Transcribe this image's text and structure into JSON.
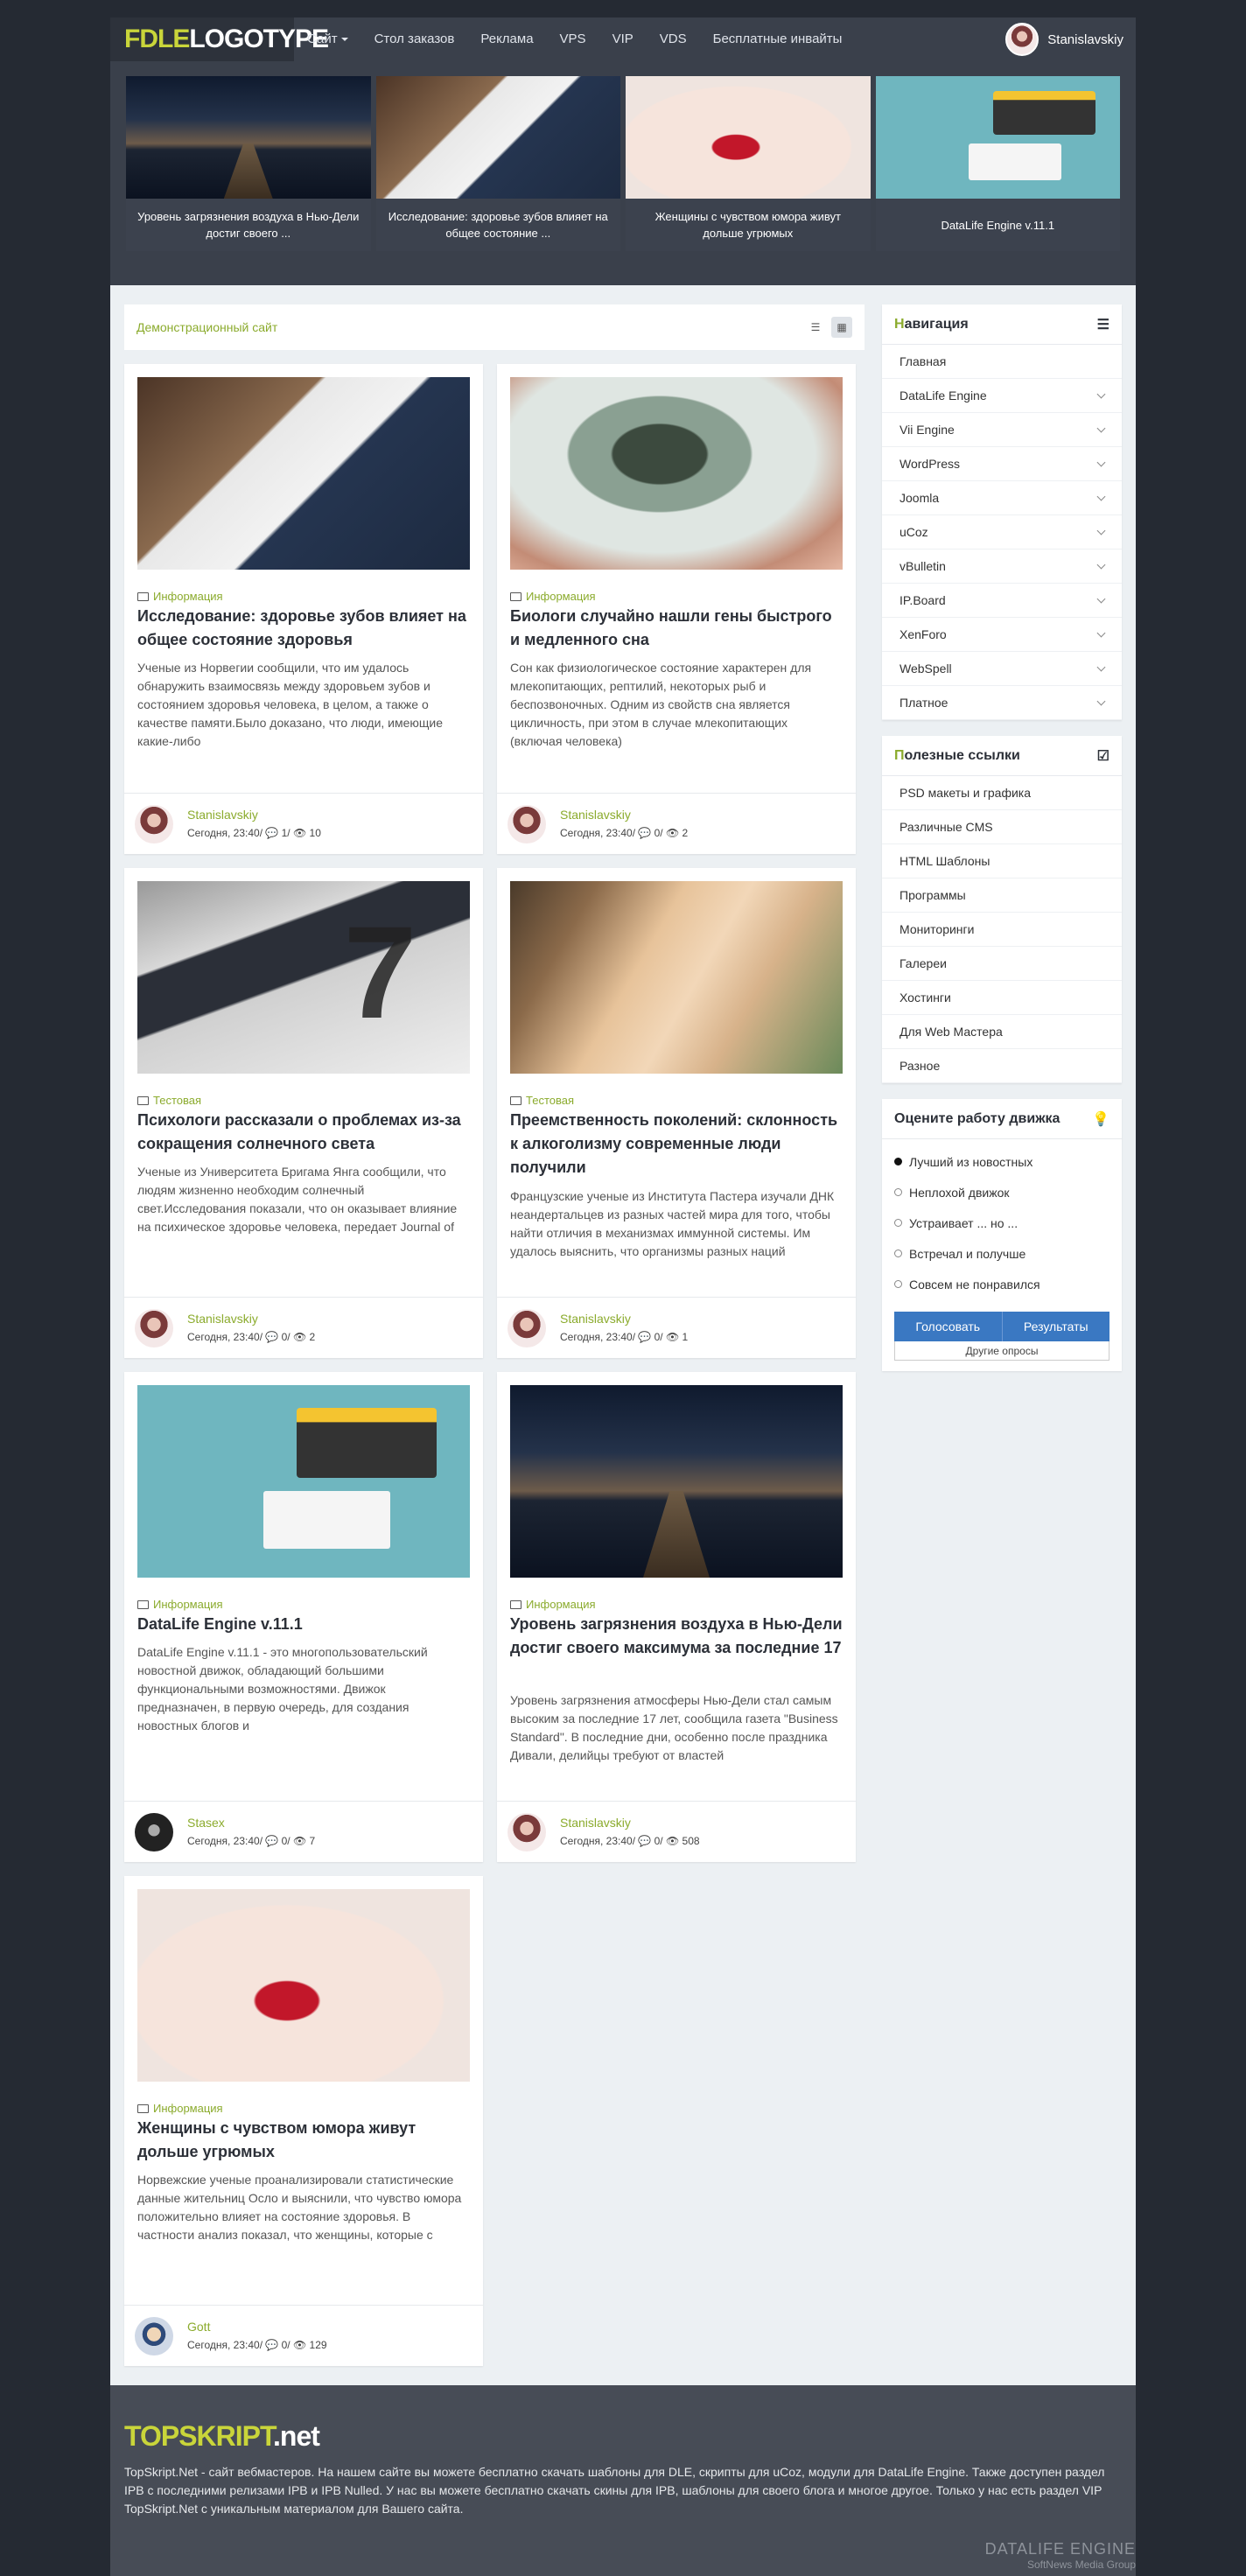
{
  "header": {
    "logo_a": "FDLE",
    "logo_b": "LOGOTYPE",
    "menu": [
      "Сайт",
      "Стол заказов",
      "Реклама",
      "VPS",
      "VIP",
      "VDS",
      "Бесплатные инвайты"
    ],
    "user_name": "Stanislavskiy"
  },
  "slider": [
    {
      "caption": "Уровень загрязнения воздуха в Нью-Дели достиг своего ..."
    },
    {
      "caption": "Исследование: здоровье зубов влияет на общее состояние ..."
    },
    {
      "caption": "Женщины с чувством юмора живут дольше угрюмых"
    },
    {
      "caption": "DataLife Engine v.11.1"
    }
  ],
  "breadcrumb": "Демонстрационный сайт",
  "icons": {
    "list_view": "list-icon",
    "grid_view": "grid-icon",
    "folder": "folder-icon",
    "comment": "comment-icon",
    "eye": "eye-icon",
    "menu": "hamburger-icon",
    "check": "checkbox-icon",
    "bulb": "lightbulb-icon"
  },
  "articles": [
    {
      "category": "Информация",
      "title": "Исследование: здоровье зубов влияет на общее состояние здоровья",
      "text": "Ученые из Норвегии сообщили, что им удалось обнаружить взаимосвязь между здоровьем зубов и состоянием здоровья человека, в целом, а также о качестве памяти.Было доказано, что люди, имеющие какие-либо",
      "author": "Stanislavskiy",
      "meta": "Сегодня, 23:40/ 💬 1/ 👁 10"
    },
    {
      "category": "Информация",
      "title": "Биологи случайно нашли гены быстрого и медленного сна",
      "text": "Сон как физиологическое состояние характерен для млекопитающих, рептилий, некоторых рыб и беспозвоночных. Одним из свойств сна является цикличность, при этом в случае млекопитающих (включая человека)",
      "author": "Stanislavskiy",
      "meta": "Сегодня, 23:40/ 💬 0/ 👁 2"
    },
    {
      "category": "Тестовая",
      "title": "Психологи рассказали о проблемах из-за сокращения солнечного света",
      "text": "Ученые из Университета Бригама Янга сообщили, что людям жизненно необходим солнечный свет.Исследования показали, что он оказывает влияние на психическое здоровье человека, передает Journal of",
      "author": "Stanislavskiy",
      "meta": "Сегодня, 23:40/ 💬 0/ 👁 2"
    },
    {
      "category": "Тестовая",
      "title": "Преемственность поколений: склонность к алкоголизму современные люди получили",
      "text": "Французские ученые из Института Пастера изучали ДНК неандертальцев из разных частей мира для того, чтобы найти отличия в механизмах иммунной системы. Им удалось выяснить, что организмы разных наций",
      "author": "Stanislavskiy",
      "meta": "Сегодня, 23:40/ 💬 0/ 👁 1"
    },
    {
      "category": "Информация",
      "title": "DataLife Engine v.11.1",
      "text": "DataLife Engine v.11.1 - это многопользовательский новостной движок, обладающий большими функциональными возможностями. Движок предназначен, в первую очередь, для создания новостных блогов и",
      "author": "Stasex",
      "meta": "Сегодня, 23:40/ 💬 0/ 👁 7"
    },
    {
      "category": "Информация",
      "title": "Уровень загрязнения воздуха в Нью-Дели достиг своего максимума за последние 17",
      "text": "Уровень загрязнения атмосферы Нью-Дели стал самым высоким за последние 17 лет, сообщила газета \"Business Standard\". В последние дни, особенно после праздника Дивали, делийцы требуют от властей",
      "author": "Stanislavskiy",
      "meta": "Сегодня, 23:40/ 💬 0/ 👁 508"
    },
    {
      "category": "Информация",
      "title": "Женщины с чувством юмора живут дольше угрюмых",
      "text": "Норвежские ученые проанализировали статистические данные жительниц Осло и выяснили, что чувство юмора положительно влияет на состояние здоровья. В частности анализ показал, что женщины, которые с",
      "author": "Gott",
      "meta": "Сегодня, 23:40/ 💬 0/ 👁 129"
    }
  ],
  "nav": {
    "title_first": "Н",
    "title_rest": "авигация",
    "items": [
      "Главная",
      "DataLife Engine",
      "Vii Engine",
      "WordPress",
      "Joomla",
      "uCoz",
      "vBulletin",
      "IP.Board",
      "XenForo",
      "WebSpell",
      "Платное"
    ]
  },
  "links": {
    "title_first": "П",
    "title_rest": "олезные ссылки",
    "items": [
      "PSD макеты и графика",
      "Различные CMS",
      "HTML Шаблоны",
      "Программы",
      "Мониторинги",
      "Галереи",
      "Хостинги",
      "Для Web Мастера",
      "Разное"
    ]
  },
  "poll": {
    "title": "Оцените работу движка",
    "options": [
      "Лучший из новостных",
      "Неплохой движок",
      "Устраивает ... но ...",
      "Встречал и получше",
      "Совсем не понравился"
    ],
    "vote_label": "Голосовать",
    "results_label": "Результаты",
    "other_label": "Другие опросы"
  },
  "footer": {
    "logo_a": "TOPSKRIPT",
    "logo_b": ".net",
    "text": "TopSkript.Net - сайт вебмастеров. На нашем сайте вы можете бесплатно скачать шаблоны для DLE, скрипты для uCoz, модули для DataLife Engine. Также доступен раздел IPB с последними релизами IPB и IPB Nulled. У нас вы можете бесплатно скачать скины для IPB, шаблоны для своего блога и многое другое. Только у нас есть раздел VIP TopSkript.Net с уникальным материалом для Вашего сайта.",
    "dle_brand": "DATALIFE ENGINE",
    "dle_sub": "SoftNews Media Group"
  },
  "colors": {
    "accent": "#8bab2d",
    "button": "#3a78c2",
    "header": "#3a404b"
  }
}
